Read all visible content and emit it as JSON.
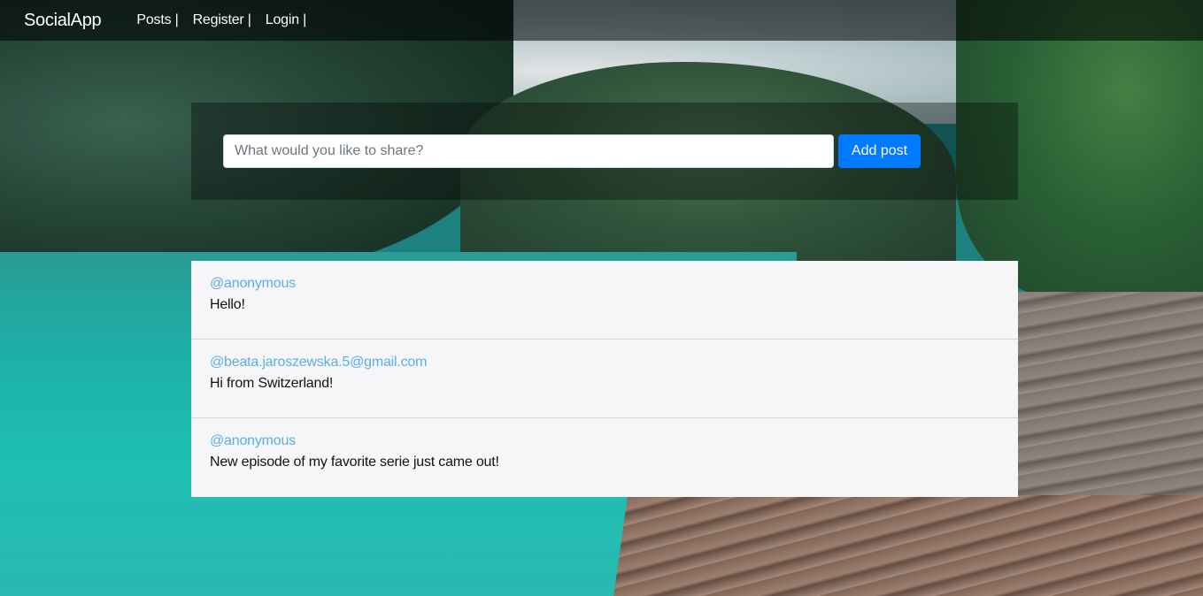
{
  "navbar": {
    "brand": "SocialApp",
    "links": [
      "Posts |",
      "Register |",
      "Login |"
    ]
  },
  "share": {
    "placeholder": "What would you like to share?",
    "button_label": "Add post"
  },
  "posts": [
    {
      "author": "@anonymous",
      "text": "Hello!"
    },
    {
      "author": "@beata.jaroszewska.5@gmail.com",
      "text": "Hi from Switzerland!"
    },
    {
      "author": "@anonymous",
      "text": "New episode of my favorite serie just came out!"
    }
  ],
  "colors": {
    "accent": "#007bff",
    "author_link": "#5aaee6",
    "navbar_bg": "rgba(0,0,0,0.55)"
  }
}
